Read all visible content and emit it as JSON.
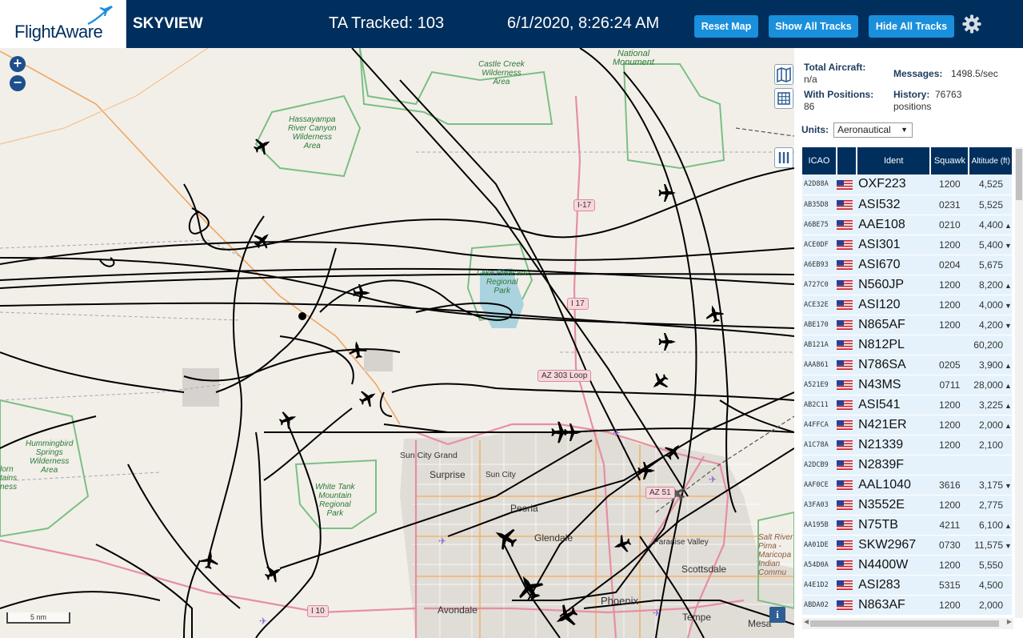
{
  "header": {
    "logo_text": "FlightAware",
    "app_title": "SKYVIEW",
    "ta_tracked": "TA Tracked: 103",
    "datetime": "6/1/2020, 8:26:24 AM",
    "reset_map": "Reset Map",
    "show_all_tracks": "Show All Tracks",
    "hide_all_tracks": "Hide All Tracks"
  },
  "colors": {
    "header_bg": "#002f5d",
    "button_bg": "#1a8fdc",
    "table_row_bg": "#e6f2fb",
    "map_bg": "#f2efe9",
    "track_color": "#000000",
    "park_green": "#7bbf84"
  },
  "map": {
    "zoom_in": "+",
    "zoom_out": "−",
    "scale_label": "5 nm",
    "info": "i",
    "places": {
      "sun_city_grand": "Sun City Grand",
      "surprise": "Surprise",
      "sun_city": "Sun City",
      "peoria": "Peoria",
      "glendale": "Glendale",
      "paradise_valley": "Paradise Valley",
      "scottsdale": "Scottsdale",
      "phoenix": "Phoenix",
      "avondale": "Avondale",
      "tempe": "Tempe",
      "mesa": "Mesa"
    },
    "parks": {
      "castle_creek": "Castle Creek\nWilderness\nArea",
      "national_monument": "National\nMonument",
      "hassayampa": "Hassayampa\nRiver Canyon\nWilderness\nArea",
      "lake_pleasant": "Lake Pleasant\nRegional\nPark",
      "hummingbird": "Hummingbird\nSprings\nWilderness\nArea",
      "white_tank": "White Tank\nMountain\nRegional\nPark",
      "harquahala": "lorn\ntains\nness",
      "salt_river": "Salt River\nPima -\nMaricopa\nIndian\nCommu"
    },
    "shields": {
      "i17_north": "I-17",
      "i17_mid": "I 17",
      "az303": "AZ 303 Loop",
      "az51": "AZ 51",
      "i10": "I 10"
    }
  },
  "panel": {
    "total_aircraft_label": "Total Aircraft:",
    "total_aircraft_value": "n/a",
    "with_positions_label": "With Positions:",
    "with_positions_value": "86",
    "messages_label": "Messages:",
    "messages_value": "1498.5/sec",
    "history_label": "History:",
    "history_value": "76763",
    "history_unit": "positions",
    "units_label": "Units:",
    "units_value": "Aeronautical",
    "columns": [
      "ICAO",
      "",
      "Ident",
      "Squawk",
      "Altitude (ft)"
    ],
    "rows": [
      {
        "icao": "A2D88A",
        "ident": "OXF223",
        "squawk": "1200",
        "alt": "4,525",
        "trend": ""
      },
      {
        "icao": "AB35D8",
        "ident": "ASI532",
        "squawk": "0231",
        "alt": "5,525",
        "trend": ""
      },
      {
        "icao": "A6BE75",
        "ident": "AAE108",
        "squawk": "0210",
        "alt": "4,400",
        "trend": "▲"
      },
      {
        "icao": "ACE0DF",
        "ident": "ASI301",
        "squawk": "1200",
        "alt": "5,400",
        "trend": "▼"
      },
      {
        "icao": "A6EB93",
        "ident": "ASI670",
        "squawk": "0204",
        "alt": "5,675",
        "trend": ""
      },
      {
        "icao": "A727C0",
        "ident": "N560JP",
        "squawk": "1200",
        "alt": "8,200",
        "trend": "▲"
      },
      {
        "icao": "ACE32E",
        "ident": "ASI120",
        "squawk": "1200",
        "alt": "4,000",
        "trend": "▼"
      },
      {
        "icao": "ABE170",
        "ident": "N865AF",
        "squawk": "1200",
        "alt": "4,200",
        "trend": "▼"
      },
      {
        "icao": "AB121A",
        "ident": "N812PL",
        "squawk": "",
        "alt": "60,200",
        "trend": ""
      },
      {
        "icao": "AAA861",
        "ident": "N786SA",
        "squawk": "0205",
        "alt": "3,900",
        "trend": "▲"
      },
      {
        "icao": "A521E9",
        "ident": "N43MS",
        "squawk": "0711",
        "alt": "28,000",
        "trend": "▲"
      },
      {
        "icao": "AB2C11",
        "ident": "ASI541",
        "squawk": "1200",
        "alt": "3,225",
        "trend": "▲"
      },
      {
        "icao": "A4FFCA",
        "ident": "N421ER",
        "squawk": "1200",
        "alt": "2,000",
        "trend": "▲"
      },
      {
        "icao": "A1C78A",
        "ident": "N21339",
        "squawk": "1200",
        "alt": "2,100",
        "trend": ""
      },
      {
        "icao": "A2DCB9",
        "ident": "N2839F",
        "squawk": "",
        "alt": "",
        "trend": ""
      },
      {
        "icao": "AAF0CE",
        "ident": "AAL1040",
        "squawk": "3616",
        "alt": "3,175",
        "trend": "▼"
      },
      {
        "icao": "A3FA03",
        "ident": "N3552E",
        "squawk": "1200",
        "alt": "2,775",
        "trend": ""
      },
      {
        "icao": "AA195B",
        "ident": "N75TB",
        "squawk": "4211",
        "alt": "6,100",
        "trend": "▲"
      },
      {
        "icao": "AA01DE",
        "ident": "SKW2967",
        "squawk": "0730",
        "alt": "11,575",
        "trend": "▼"
      },
      {
        "icao": "A54D0A",
        "ident": "N4400W",
        "squawk": "1200",
        "alt": "5,550",
        "trend": ""
      },
      {
        "icao": "A4E1D2",
        "ident": "ASI283",
        "squawk": "5315",
        "alt": "4,500",
        "trend": ""
      },
      {
        "icao": "ABDA02",
        "ident": "N863AF",
        "squawk": "1200",
        "alt": "2,000",
        "trend": ""
      }
    ]
  }
}
